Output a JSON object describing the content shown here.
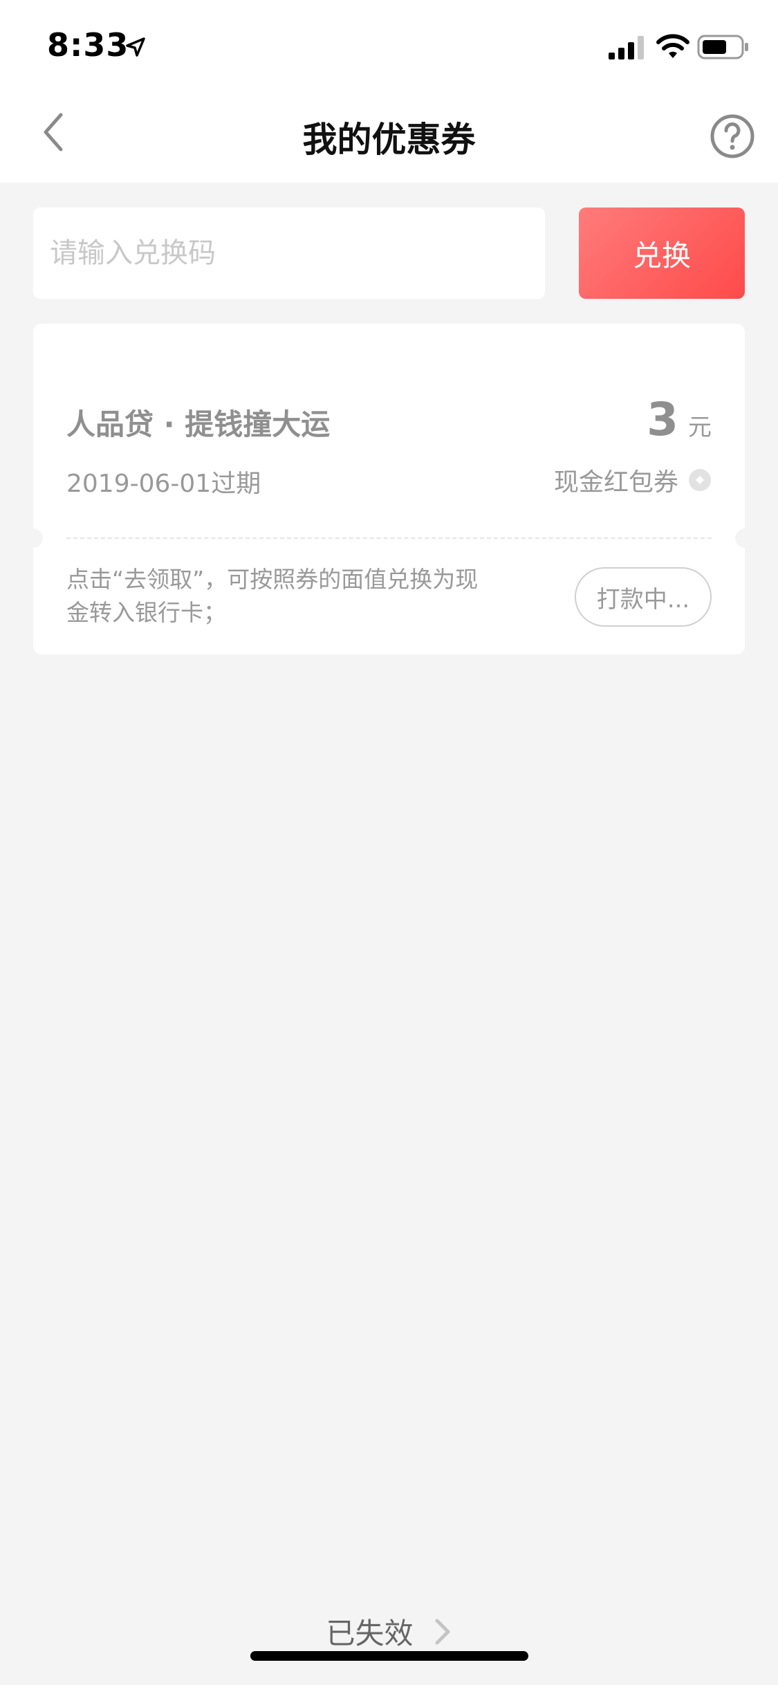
{
  "status_bar": {
    "time": "8:33"
  },
  "nav": {
    "title": "我的优惠券"
  },
  "redeem": {
    "placeholder": "请输入兑换码",
    "button_label": "兑换"
  },
  "coupon": {
    "title": "人品贷 · 提钱撞大运",
    "expiry": "2019-06-01过期",
    "amount": "3",
    "unit": "元",
    "type": "现金红包券",
    "description": "点击“去领取”，可按照券的面值兑换为现金转入银行卡；",
    "status_label": "打款中..."
  },
  "footer": {
    "expired_label": "已失效"
  },
  "colors": {
    "accent": "#ff5a5a",
    "background": "#f4f4f4"
  }
}
